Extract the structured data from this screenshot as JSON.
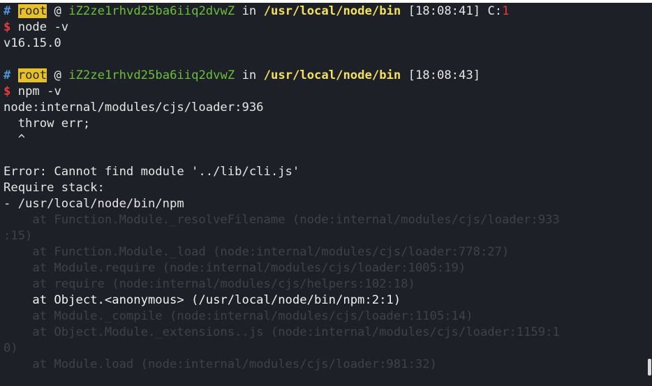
{
  "prompt1": {
    "hash": "#",
    "user": "root",
    "at": "@",
    "host": "iZ2ze1rhvd25ba6iiq2dvwZ",
    "in": "in",
    "path": "/usr/local/node/bin",
    "time": "[18:08:41]",
    "exit_label": "C:",
    "exit_code": "1"
  },
  "cmd1": {
    "dollar": "$",
    "text": "node -v"
  },
  "out1": [
    "v16.15.0"
  ],
  "prompt2": {
    "hash": "#",
    "user": "root",
    "at": "@",
    "host": "iZ2ze1rhvd25ba6iiq2dvwZ",
    "in": "in",
    "path": "/usr/local/node/bin",
    "time": "[18:08:43]"
  },
  "cmd2": {
    "dollar": "$",
    "text": "npm -v"
  },
  "out2": [
    "node:internal/modules/cjs/loader:936",
    "  throw err;",
    "  ^",
    "",
    "Error: Cannot find module '../lib/cli.js'",
    "Require stack:",
    "- /usr/local/node/bin/npm"
  ],
  "stack": [
    "    at Function.Module._resolveFilename (node:internal/modules/cjs/loader:933",
    ":15)",
    "    at Function.Module._load (node:internal/modules/cjs/loader:778:27)",
    "    at Module.require (node:internal/modules/cjs/loader:1005:19)",
    "    at require (node:internal/modules/cjs/helpers:102:18)",
    "    at Object.<anonymous> (/usr/local/node/bin/npm:2:1)",
    "    at Module._compile (node:internal/modules/cjs/loader:1105:14)",
    "    at Object.Module._extensions..js (node:internal/modules/cjs/loader:1159:1",
    "0)",
    "    at Module.load (node:internal/modules/cjs/loader:981:32)"
  ]
}
